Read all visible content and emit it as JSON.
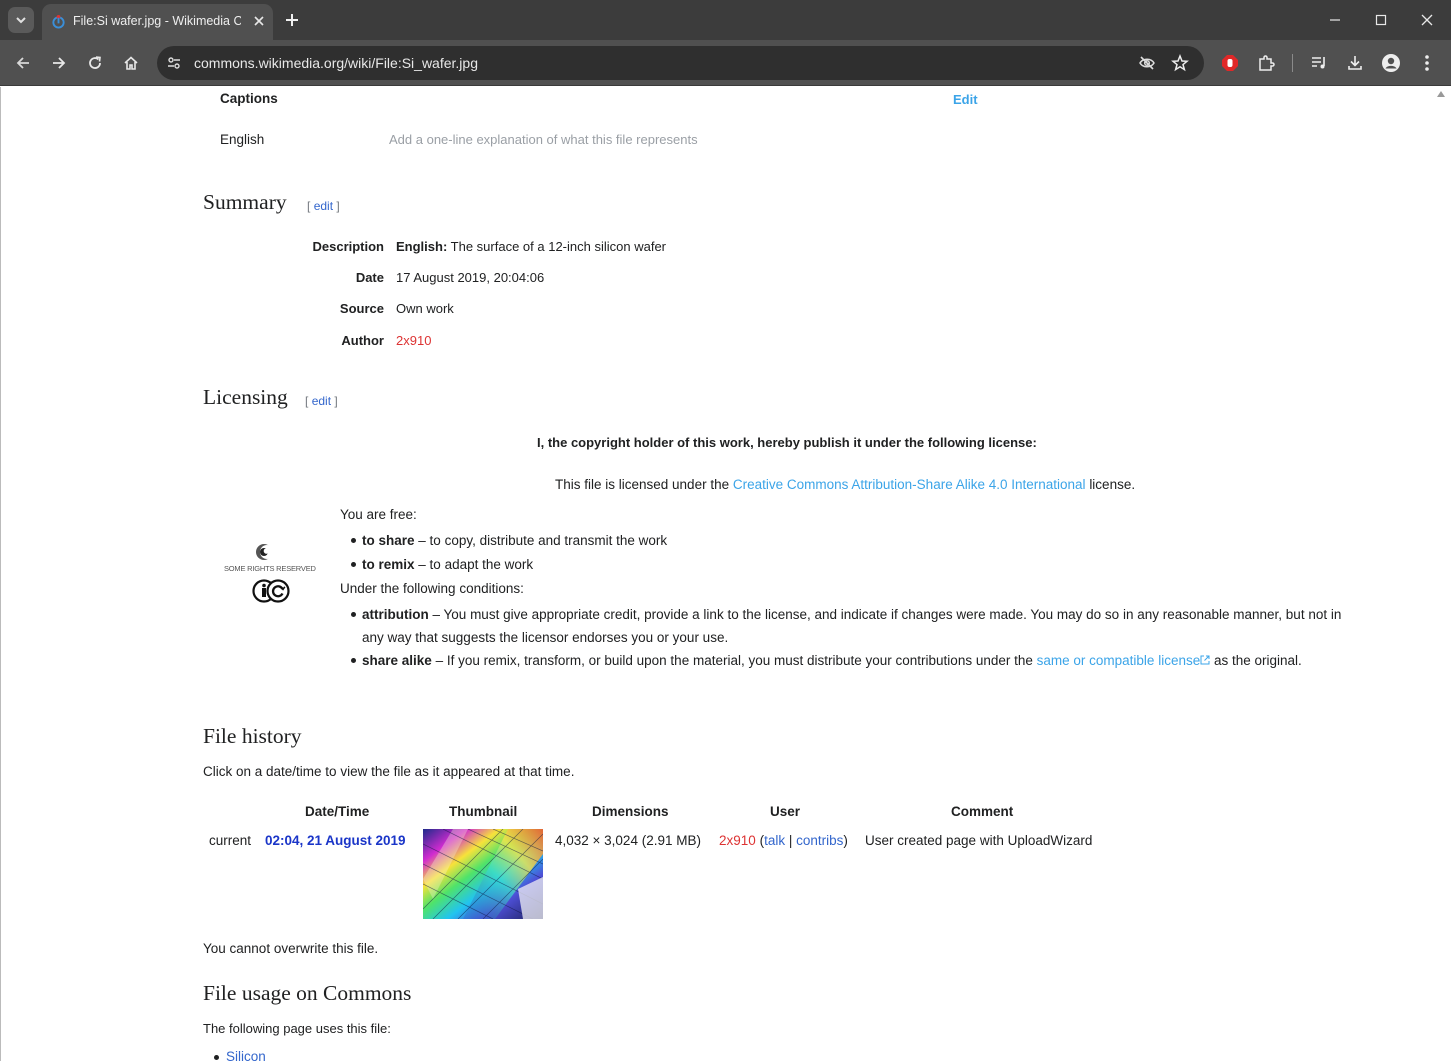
{
  "browser": {
    "tab_title": "File:Si wafer.jpg - Wikimedia Commons",
    "url": "commons.wikimedia.org/wiki/File:Si_wafer.jpg"
  },
  "captions": {
    "heading": "Captions",
    "edit_label": "Edit",
    "language": "English",
    "placeholder": "Add a one-line explanation of what this file represents"
  },
  "summary": {
    "heading": "Summary",
    "edit_open": "[",
    "edit_label": "edit",
    "edit_close": "]",
    "rows": [
      {
        "label": "Description",
        "lang": "English:",
        "value": "The surface of a 12-inch silicon wafer"
      },
      {
        "label": "Date",
        "value": "17 August 2019, 20:04:06"
      },
      {
        "label": "Source",
        "value": "Own work"
      },
      {
        "label": "Author",
        "value": "2x910"
      }
    ]
  },
  "licensing": {
    "heading": "Licensing",
    "edit_label": "edit",
    "intro": "I, the copyright holder of this work, hereby publish it under the following license:",
    "license_pre": "This file is licensed under the",
    "license_link": "Creative Commons Attribution-Share Alike 4.0 International",
    "license_post": "license.",
    "cc_badge_text": "SOME RIGHTS RESERVED",
    "free_label": "You are free:",
    "free_items": [
      {
        "term": "to share",
        "desc": "– to copy, distribute and transmit the work"
      },
      {
        "term": "to remix",
        "desc": "– to adapt the work"
      }
    ],
    "conditions_label": "Under the following conditions:",
    "attribution_term": "attribution",
    "attribution_desc_1": "– You must give appropriate credit, provide a link to the license, and indicate if changes were made. You may do so in any reasonable manner, but not in",
    "attribution_desc_2": "any way that suggests the licensor endorses you or your use.",
    "sharealike_term": "share alike",
    "sharealike_desc": "– If you remix, transform, or build upon the material, you must distribute your contributions under the",
    "sharealike_link": "same or compatible license",
    "sharealike_post": "as the original."
  },
  "file_history": {
    "heading": "File history",
    "note": "Click on a date/time to view the file as it appeared at that time.",
    "columns": [
      "Date/Time",
      "Thumbnail",
      "Dimensions",
      "User",
      "Comment"
    ],
    "row": {
      "status": "current",
      "datetime": "02:04, 21 August 2019",
      "dimensions": "4,032 × 3,024 (2.91 MB)",
      "user": "2x910",
      "user_open": "(",
      "talk": "talk",
      "sep": "|",
      "contribs": "contribs",
      "user_close": ")",
      "comment": "User created page with UploadWizard"
    },
    "overwrite_note": "You cannot overwrite this file."
  },
  "file_usage": {
    "heading": "File usage on Commons",
    "note": "The following page uses this file:",
    "pages": [
      "Silicon"
    ]
  },
  "colors": {
    "link": "#3366cc",
    "light_link": "#3ba4e8",
    "redlink": "#dd3333",
    "chrome_dark": "#3c3c3c",
    "chrome_toolbar": "#505050"
  }
}
